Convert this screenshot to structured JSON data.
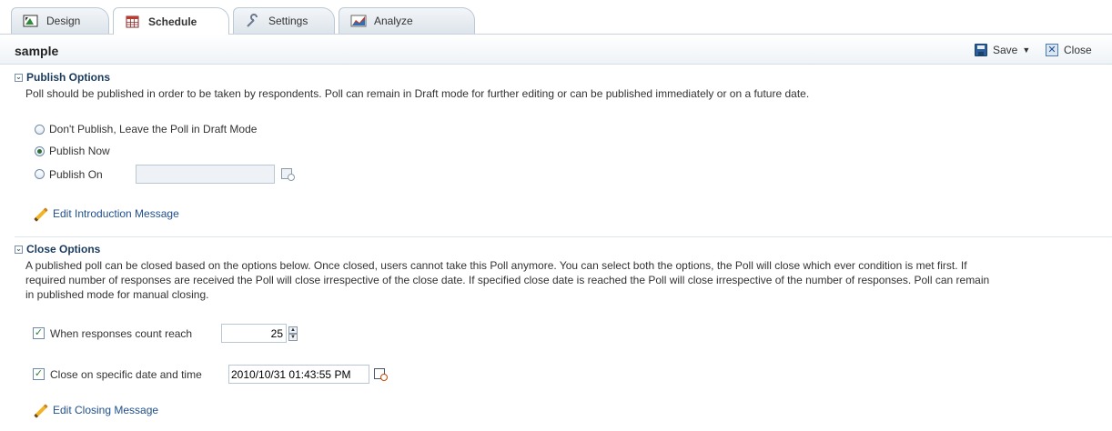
{
  "tabs": [
    {
      "label": "Design",
      "icon": "design-icon"
    },
    {
      "label": "Schedule",
      "icon": "calendar-grid-icon",
      "active": true
    },
    {
      "label": "Settings",
      "icon": "wrench-icon"
    },
    {
      "label": "Analyze",
      "icon": "chart-icon"
    }
  ],
  "header": {
    "title": "sample",
    "save_label": "Save",
    "close_label": "Close"
  },
  "publish": {
    "title": "Publish Options",
    "description": "Poll should be published in order to be taken by respondents. Poll can remain in Draft mode for further editing or can be published immediately or on a future date.",
    "options": [
      {
        "label": "Don't Publish, Leave the Poll in Draft Mode",
        "selected": false
      },
      {
        "label": "Publish Now",
        "selected": true
      },
      {
        "label": "Publish On",
        "selected": false
      }
    ],
    "publish_on_value": "",
    "edit_link": "Edit Introduction Message"
  },
  "close": {
    "title": "Close Options",
    "description_lines": [
      "A published poll can be closed based on the options below. Once closed, users cannot take this Poll anymore. You can select both the options, the Poll will close which ever condition is met first. If",
      "required number of responses are received the Poll will close irrespective of the close date. If specified close date is reached the Poll will close irrespective of the number of responses. Poll can remain",
      "in published mode for manual closing."
    ],
    "responses_label": "When responses count reach",
    "responses_checked": true,
    "responses_value": "25",
    "date_label": "Close on specific date and time",
    "date_checked": true,
    "date_value": "2010/10/31 01:43:55 PM",
    "edit_link": "Edit Closing Message"
  }
}
